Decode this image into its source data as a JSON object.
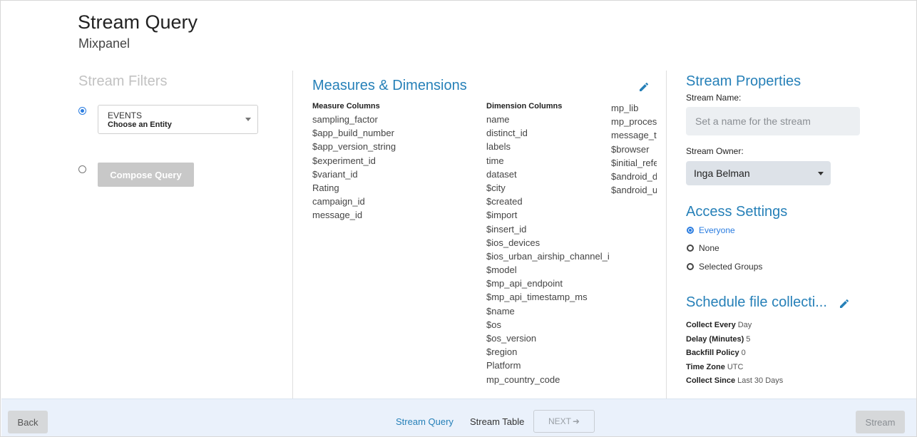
{
  "header": {
    "title": "Stream Query",
    "subtitle": "Mixpanel"
  },
  "filters": {
    "title": "Stream Filters",
    "entity_select": {
      "label": "EVENTS",
      "value": "Choose an Entity"
    },
    "compose_label": "Compose Query"
  },
  "measures": {
    "title": "Measures & Dimensions",
    "measure_header": "Measure Columns",
    "measure_columns": [
      "sampling_factor",
      "$app_build_number",
      "$app_version_string",
      "$experiment_id",
      "$variant_id",
      "Rating",
      "campaign_id",
      "message_id"
    ],
    "dimension_header": "Dimension Columns",
    "dimension_columns": [
      "name",
      "distinct_id",
      "labels",
      "time",
      "dataset",
      "$city",
      "$created",
      "$import",
      "$insert_id",
      "$ios_devices",
      "$ios_urban_airship_channel_id",
      "$model",
      "$mp_api_endpoint",
      "$mp_api_timestamp_ms",
      "$name",
      "$os",
      "$os_version",
      "$region",
      "Platform",
      "mp_country_code"
    ],
    "dimension_columns_2": [
      "mp_lib",
      "mp_process",
      "message_ty",
      "$browser",
      "$initial_refe",
      "$android_de",
      "$android_u"
    ]
  },
  "properties": {
    "title": "Stream Properties",
    "name_label": "Stream Name:",
    "name_placeholder": "Set a name for the stream",
    "owner_label": "Stream Owner:",
    "owner_value": "Inga Belman"
  },
  "access": {
    "title": "Access Settings",
    "options": [
      "Everyone",
      "None",
      "Selected Groups"
    ],
    "selected": "Everyone"
  },
  "schedule": {
    "title": "Schedule file collecti...",
    "rows": [
      {
        "label": "Collect Every",
        "value": "Day"
      },
      {
        "label": "Delay (Minutes)",
        "value": "5"
      },
      {
        "label": "Backfill Policy",
        "value": "0"
      },
      {
        "label": "Time Zone",
        "value": "UTC"
      },
      {
        "label": "Collect Since",
        "value": "Last 30 Days"
      }
    ]
  },
  "footer": {
    "back_label": "Back",
    "step_query": "Stream Query",
    "step_table": "Stream Table",
    "next_label": "NEXT",
    "stream_label": "Stream"
  },
  "colors": {
    "accent": "#2680b8",
    "radio": "#2a7ce0",
    "footer_bg": "#eaf1fb"
  }
}
